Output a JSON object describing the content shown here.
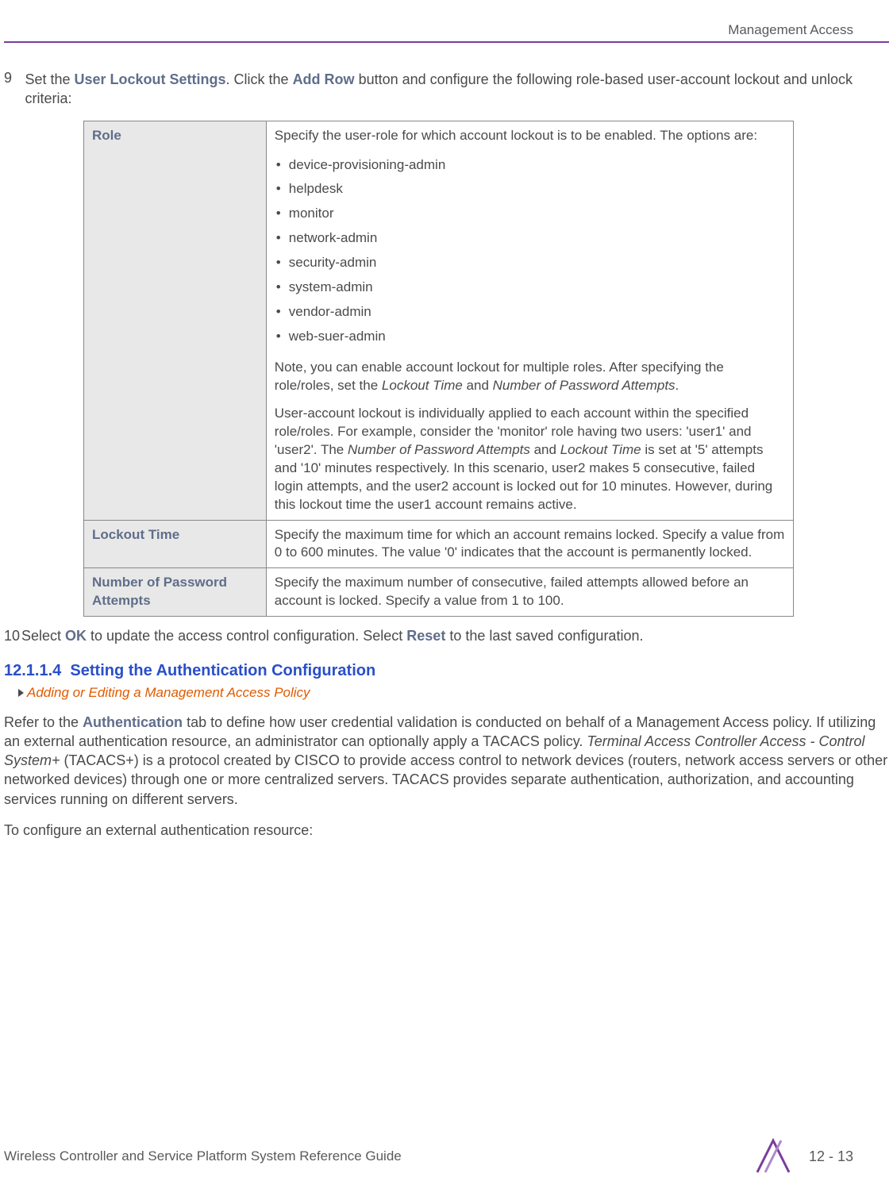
{
  "header": {
    "section_title": "Management Access"
  },
  "step9": {
    "number": "9",
    "text_prefix": "Set the ",
    "bold1": "User Lockout Settings",
    "text_mid": ". Click the ",
    "bold2": "Add Row",
    "text_suffix": " button and configure the following role-based user-account lockout and unlock criteria:"
  },
  "table": {
    "row1_label": "Role",
    "row1_intro": "Specify the user-role for which account lockout is to be enabled. The options are:",
    "row1_bullets": [
      "device-provisioning-admin",
      "helpdesk",
      "monitor",
      "network-admin",
      "security-admin",
      "system-admin",
      "vendor-admin",
      "web-suer-admin"
    ],
    "row1_note_prefix": "Note, you can enable account lockout for multiple roles. After specifying the role/roles, set the ",
    "row1_note_italic1": "Lockout Time",
    "row1_note_mid": " and ",
    "row1_note_italic2": "Number of Password Attempts",
    "row1_note_suffix": ".",
    "row1_example_prefix": "User-account lockout is individually applied to each account within the specified role/roles. For example, consider the 'monitor' role having two users: 'user1' and 'user2'. The ",
    "row1_example_italic1": "Number of Password Attempts",
    "row1_example_mid1": " and ",
    "row1_example_italic2": "Lockout Time",
    "row1_example_suffix": " is set at '5' attempts and '10' minutes respectively. In this scenario, user2 makes 5 consecutive, failed login attempts, and the user2 account is locked out for 10 minutes. However, during this lockout time the user1 account remains active.",
    "row2_label": "Lockout Time",
    "row2_value": "Specify the maximum time for which an account remains locked. Specify a value from 0 to 600 minutes. The value '0' indicates that the account is permanently locked.",
    "row3_label": "Number of Password Attempts",
    "row3_value": "Specify the maximum number of consecutive, failed attempts allowed before an account is locked. Specify a value from 1 to 100."
  },
  "step10": {
    "number": "10",
    "text_prefix": "Select ",
    "bold1": "OK",
    "text_mid": " to update the access control configuration. Select ",
    "bold2": "Reset",
    "text_suffix": " to the last saved configuration."
  },
  "section": {
    "number": "12.1.1.4",
    "title": "Setting the Authentication Configuration"
  },
  "breadcrumb": {
    "text": "Adding or Editing a Management Access Policy"
  },
  "para1": {
    "prefix": "Refer to the ",
    "bold1": "Authentication",
    "mid1": " tab to define how user credential validation is conducted on behalf of a Management Access policy. If utilizing an external authentication resource, an administrator can optionally apply a TACACS policy. ",
    "italic1": "Terminal Access Controller Access - Control System+",
    "suffix": " (TACACS+) is a protocol created by CISCO to provide access control to network devices (routers, network access servers or other networked devices) through one or more centralized servers. TACACS provides separate authentication, authorization, and accounting services running on different servers."
  },
  "para2": "To configure an external authentication resource:",
  "footer": {
    "guide_title": "Wireless Controller and Service Platform System Reference Guide",
    "page_number": "12 - 13"
  }
}
